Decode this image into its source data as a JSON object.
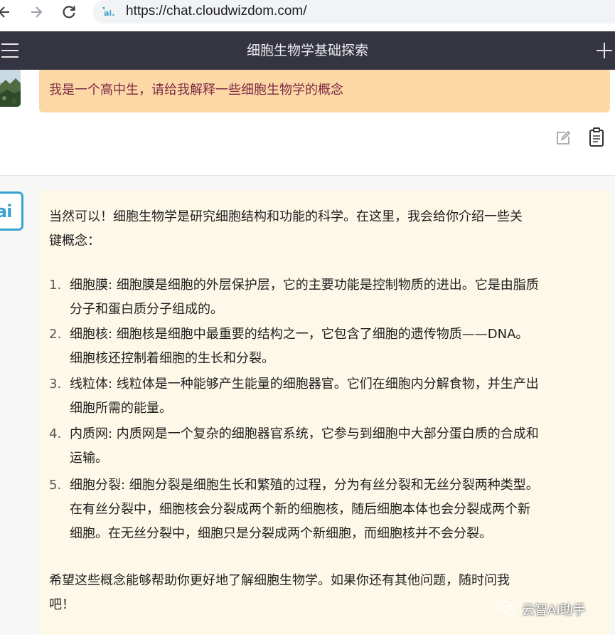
{
  "browser": {
    "url": "https://chat.cloudwizdom.com/",
    "site_icon": "cloudwizdom-ai-logo"
  },
  "header": {
    "title": "细胞生物学基础探索"
  },
  "user_message": {
    "text": "我是一个高中生，请给我解释一些细胞生物学的概念"
  },
  "assistant_message": {
    "avatar_text": "ai",
    "intro_lines": [
      "当然可以！细胞生物学是研究细胞结构和功能的科学。在这里，我会给你介绍一些关",
      "键概念："
    ],
    "items": [
      {
        "num": "1.",
        "lines": [
          "细胞膜: 细胞膜是细胞的外层保护层，它的主要功能是控制物质的进出。它是由脂质",
          "分子和蛋白质分子组成的。"
        ]
      },
      {
        "num": "2.",
        "lines": [
          "细胞核: 细胞核是细胞中最重要的结构之一，它包含了细胞的遗传物质——DNA。",
          "细胞核还控制着细胞的生长和分裂。"
        ]
      },
      {
        "num": "3.",
        "lines": [
          "线粒体: 线粒体是一种能够产生能量的细胞器官。它们在细胞内分解食物，并生产出",
          "细胞所需的能量。"
        ]
      },
      {
        "num": "4.",
        "lines": [
          "内质网: 内质网是一个复杂的细胞器官系统，它参与到细胞中大部分蛋白质的合成和",
          "运输。"
        ]
      },
      {
        "num": "5.",
        "lines": [
          "细胞分裂: 细胞分裂是细胞生长和繁殖的过程，分为有丝分裂和无丝分裂两种类型。",
          "在有丝分裂中，细胞核会分裂成两个新的细胞核，随后细胞本体也会分裂成两个新",
          "细胞。在无丝分裂中，细胞只是分裂成两个新细胞，而细胞核并不会分裂。"
        ]
      }
    ],
    "outro_lines": [
      "希望这些概念能够帮助你更好地了解细胞生物学。如果你还有其他问题，随时问我",
      "吧！"
    ]
  },
  "watermark": {
    "text": "云智AI助手"
  },
  "colors": {
    "header_bg": "#343541",
    "user_bubble": "#fcd8a6",
    "user_text": "#7d2a44",
    "assistant_bubble": "#fdf8e8",
    "accent": "#35a2cf"
  }
}
